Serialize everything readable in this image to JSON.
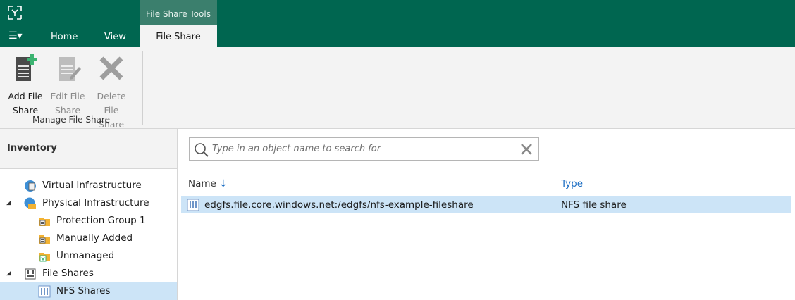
{
  "ribbon_context": {
    "group_title": "File Share Tools"
  },
  "tabs": {
    "home": "Home",
    "view": "View",
    "active": "File Share"
  },
  "ribbon": {
    "add_line1": "Add File",
    "add_line2": "Share",
    "edit_line1": "Edit File",
    "edit_line2": "Share",
    "delete_line1": "Delete",
    "delete_line2": "File Share",
    "group_label": "Manage File Share"
  },
  "inventory": {
    "title": "Inventory",
    "tree": [
      {
        "label": "Virtual Infrastructure"
      },
      {
        "label": "Physical Infrastructure"
      },
      {
        "label": "Protection Group 1"
      },
      {
        "label": "Manually Added"
      },
      {
        "label": "Unmanaged"
      },
      {
        "label": "File Shares"
      },
      {
        "label": "NFS Shares"
      }
    ]
  },
  "search": {
    "placeholder": "Type in an object name to search for"
  },
  "list": {
    "columns": {
      "name": "Name",
      "type": "Type"
    },
    "rows": [
      {
        "name": "edgfs.file.core.windows.net:/edgfs/nfs-example-fileshare",
        "type": "NFS file share"
      }
    ]
  },
  "colors": {
    "title_bar": "#006650",
    "context_tab": "#3b7f6d",
    "selection": "#cce4f7",
    "accent_blue": "#1e6fc4"
  }
}
